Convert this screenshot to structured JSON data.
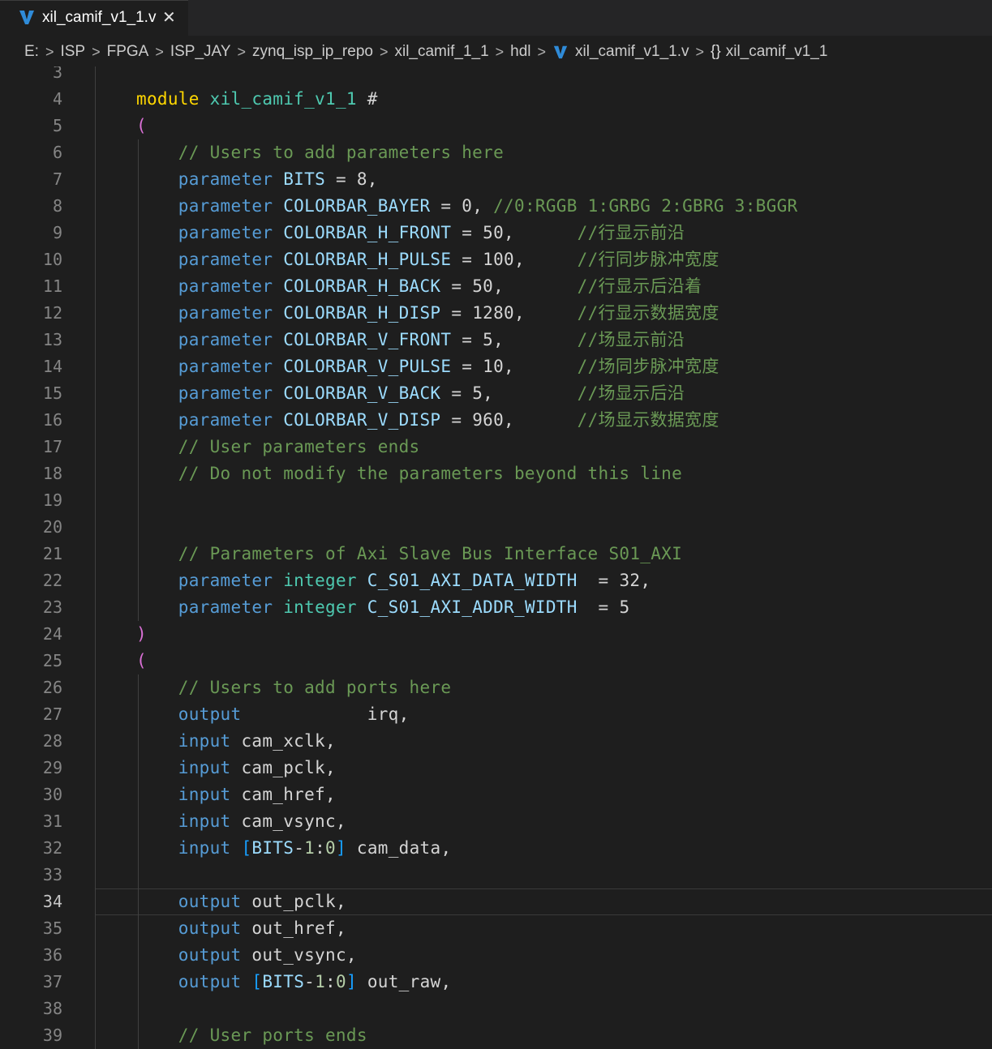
{
  "tab": {
    "filename": "xil_camif_v1_1.v",
    "icon": "verilog-v-icon",
    "close": "✕"
  },
  "breadcrumb": {
    "items": [
      "E:",
      "ISP",
      "FPGA",
      "ISP_JAY",
      "zynq_isp_ip_repo",
      "xil_camif_1_1",
      "hdl"
    ],
    "file": "xil_camif_v1_1.v",
    "symbol_icon": "{}",
    "symbol": "xil_camif_v1_1"
  },
  "editor": {
    "active_line": 34,
    "lines": [
      {
        "n": "3",
        "tokens": []
      },
      {
        "n": "4",
        "tokens": [
          [
            "kw2",
            "module"
          ],
          [
            "plain",
            " "
          ],
          [
            "mod",
            "xil_camif_v1_1"
          ],
          [
            "plain",
            " #"
          ]
        ]
      },
      {
        "n": "5",
        "tokens": [
          [
            "par",
            "("
          ]
        ]
      },
      {
        "n": "6",
        "tokens": [
          [
            "plain",
            "    "
          ],
          [
            "cm",
            "// Users to add parameters here"
          ]
        ]
      },
      {
        "n": "7",
        "tokens": [
          [
            "plain",
            "    "
          ],
          [
            "kw",
            "parameter"
          ],
          [
            "plain",
            " "
          ],
          [
            "id",
            "BITS"
          ],
          [
            "plain",
            " = 8,"
          ]
        ]
      },
      {
        "n": "8",
        "tokens": [
          [
            "plain",
            "    "
          ],
          [
            "kw",
            "parameter"
          ],
          [
            "plain",
            " "
          ],
          [
            "id",
            "COLORBAR_BAYER"
          ],
          [
            "plain",
            " = 0, "
          ],
          [
            "cm",
            "//0:RGGB 1:GRBG 2:GBRG 3:BGGR"
          ]
        ]
      },
      {
        "n": "9",
        "tokens": [
          [
            "plain",
            "    "
          ],
          [
            "kw",
            "parameter"
          ],
          [
            "plain",
            " "
          ],
          [
            "id",
            "COLORBAR_H_FRONT"
          ],
          [
            "plain",
            " = 50,      "
          ],
          [
            "cm",
            "//行显示前沿"
          ]
        ]
      },
      {
        "n": "10",
        "tokens": [
          [
            "plain",
            "    "
          ],
          [
            "kw",
            "parameter"
          ],
          [
            "plain",
            " "
          ],
          [
            "id",
            "COLORBAR_H_PULSE"
          ],
          [
            "plain",
            " = 100,     "
          ],
          [
            "cm",
            "//行同步脉冲宽度"
          ]
        ]
      },
      {
        "n": "11",
        "tokens": [
          [
            "plain",
            "    "
          ],
          [
            "kw",
            "parameter"
          ],
          [
            "plain",
            " "
          ],
          [
            "id",
            "COLORBAR_H_BACK"
          ],
          [
            "plain",
            " = 50,       "
          ],
          [
            "cm",
            "//行显示后沿着"
          ]
        ]
      },
      {
        "n": "12",
        "tokens": [
          [
            "plain",
            "    "
          ],
          [
            "kw",
            "parameter"
          ],
          [
            "plain",
            " "
          ],
          [
            "id",
            "COLORBAR_H_DISP"
          ],
          [
            "plain",
            " = 1280,     "
          ],
          [
            "cm",
            "//行显示数据宽度"
          ]
        ]
      },
      {
        "n": "13",
        "tokens": [
          [
            "plain",
            "    "
          ],
          [
            "kw",
            "parameter"
          ],
          [
            "plain",
            " "
          ],
          [
            "id",
            "COLORBAR_V_FRONT"
          ],
          [
            "plain",
            " = 5,       "
          ],
          [
            "cm",
            "//场显示前沿"
          ]
        ]
      },
      {
        "n": "14",
        "tokens": [
          [
            "plain",
            "    "
          ],
          [
            "kw",
            "parameter"
          ],
          [
            "plain",
            " "
          ],
          [
            "id",
            "COLORBAR_V_PULSE"
          ],
          [
            "plain",
            " = 10,      "
          ],
          [
            "cm",
            "//场同步脉冲宽度"
          ]
        ]
      },
      {
        "n": "15",
        "tokens": [
          [
            "plain",
            "    "
          ],
          [
            "kw",
            "parameter"
          ],
          [
            "plain",
            " "
          ],
          [
            "id",
            "COLORBAR_V_BACK"
          ],
          [
            "plain",
            " = 5,        "
          ],
          [
            "cm",
            "//场显示后沿"
          ]
        ]
      },
      {
        "n": "16",
        "tokens": [
          [
            "plain",
            "    "
          ],
          [
            "kw",
            "parameter"
          ],
          [
            "plain",
            " "
          ],
          [
            "id",
            "COLORBAR_V_DISP"
          ],
          [
            "plain",
            " = 960,      "
          ],
          [
            "cm",
            "//场显示数据宽度"
          ]
        ]
      },
      {
        "n": "17",
        "tokens": [
          [
            "plain",
            "    "
          ],
          [
            "cm",
            "// User parameters ends"
          ]
        ]
      },
      {
        "n": "18",
        "tokens": [
          [
            "plain",
            "    "
          ],
          [
            "cm",
            "// Do not modify the parameters beyond this line"
          ]
        ]
      },
      {
        "n": "19",
        "tokens": []
      },
      {
        "n": "20",
        "tokens": []
      },
      {
        "n": "21",
        "tokens": [
          [
            "plain",
            "    "
          ],
          [
            "cm",
            "// Parameters of Axi Slave Bus Interface S01_AXI"
          ]
        ]
      },
      {
        "n": "22",
        "tokens": [
          [
            "plain",
            "    "
          ],
          [
            "kw",
            "parameter"
          ],
          [
            "plain",
            " "
          ],
          [
            "ty",
            "integer"
          ],
          [
            "plain",
            " "
          ],
          [
            "id",
            "C_S01_AXI_DATA_WIDTH"
          ],
          [
            "plain",
            "  = 32,"
          ]
        ]
      },
      {
        "n": "23",
        "tokens": [
          [
            "plain",
            "    "
          ],
          [
            "kw",
            "parameter"
          ],
          [
            "plain",
            " "
          ],
          [
            "ty",
            "integer"
          ],
          [
            "plain",
            " "
          ],
          [
            "id",
            "C_S01_AXI_ADDR_WIDTH"
          ],
          [
            "plain",
            "  = 5"
          ]
        ]
      },
      {
        "n": "24",
        "tokens": [
          [
            "par",
            ")"
          ]
        ]
      },
      {
        "n": "25",
        "tokens": [
          [
            "par",
            "("
          ]
        ]
      },
      {
        "n": "26",
        "tokens": [
          [
            "plain",
            "    "
          ],
          [
            "cm",
            "// Users to add ports here"
          ]
        ]
      },
      {
        "n": "27",
        "tokens": [
          [
            "plain",
            "    "
          ],
          [
            "kw",
            "output"
          ],
          [
            "plain",
            "            irq,"
          ]
        ]
      },
      {
        "n": "28",
        "tokens": [
          [
            "plain",
            "    "
          ],
          [
            "kw",
            "input"
          ],
          [
            "plain",
            " cam_xclk,"
          ]
        ]
      },
      {
        "n": "29",
        "tokens": [
          [
            "plain",
            "    "
          ],
          [
            "kw",
            "input"
          ],
          [
            "plain",
            " cam_pclk,"
          ]
        ]
      },
      {
        "n": "30",
        "tokens": [
          [
            "plain",
            "    "
          ],
          [
            "kw",
            "input"
          ],
          [
            "plain",
            " cam_href,"
          ]
        ]
      },
      {
        "n": "31",
        "tokens": [
          [
            "plain",
            "    "
          ],
          [
            "kw",
            "input"
          ],
          [
            "plain",
            " cam_vsync,"
          ]
        ]
      },
      {
        "n": "32",
        "tokens": [
          [
            "plain",
            "    "
          ],
          [
            "kw",
            "input"
          ],
          [
            "plain",
            " "
          ],
          [
            "brk",
            "["
          ],
          [
            "id",
            "BITS"
          ],
          [
            "plain",
            "-"
          ],
          [
            "num",
            "1"
          ],
          [
            "plain",
            ":"
          ],
          [
            "num",
            "0"
          ],
          [
            "brk",
            "]"
          ],
          [
            "plain",
            " cam_data,"
          ]
        ]
      },
      {
        "n": "33",
        "tokens": []
      },
      {
        "n": "34",
        "tokens": [
          [
            "plain",
            "    "
          ],
          [
            "kw",
            "output"
          ],
          [
            "plain",
            " out_pclk,"
          ]
        ]
      },
      {
        "n": "35",
        "tokens": [
          [
            "plain",
            "    "
          ],
          [
            "kw",
            "output"
          ],
          [
            "plain",
            " out_href,"
          ]
        ]
      },
      {
        "n": "36",
        "tokens": [
          [
            "plain",
            "    "
          ],
          [
            "kw",
            "output"
          ],
          [
            "plain",
            " out_vsync,"
          ]
        ]
      },
      {
        "n": "37",
        "tokens": [
          [
            "plain",
            "    "
          ],
          [
            "kw",
            "output"
          ],
          [
            "plain",
            " "
          ],
          [
            "brk",
            "["
          ],
          [
            "id",
            "BITS"
          ],
          [
            "plain",
            "-"
          ],
          [
            "num",
            "1"
          ],
          [
            "plain",
            ":"
          ],
          [
            "num",
            "0"
          ],
          [
            "brk",
            "]"
          ],
          [
            "plain",
            " out_raw,"
          ]
        ]
      },
      {
        "n": "38",
        "tokens": []
      },
      {
        "n": "39",
        "tokens": [
          [
            "plain",
            "    "
          ],
          [
            "cm",
            "// User ports ends"
          ]
        ]
      }
    ]
  }
}
